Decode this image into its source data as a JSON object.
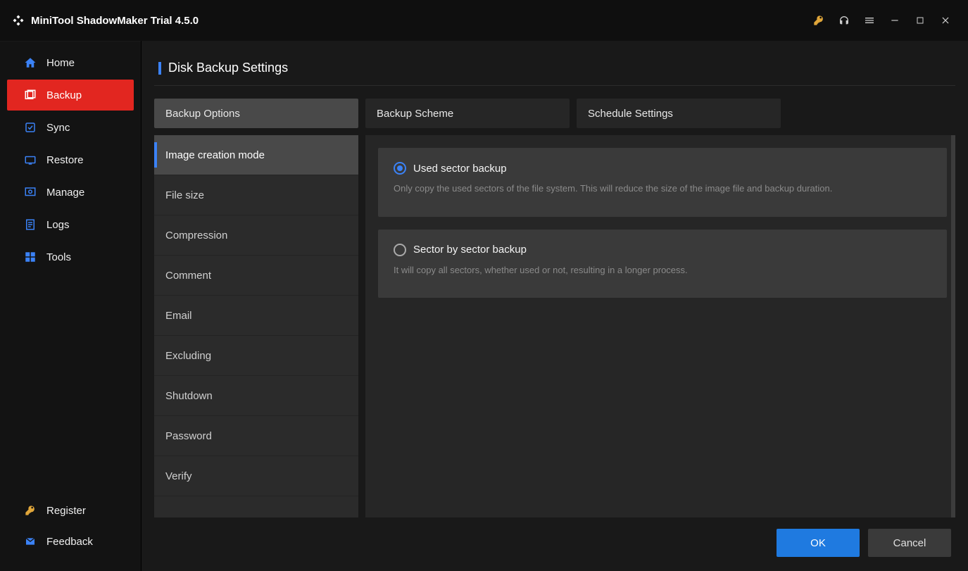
{
  "title": "MiniTool ShadowMaker Trial 4.5.0",
  "titlebar_icons": [
    "key-icon",
    "headphones-icon",
    "menu-icon",
    "minimize-icon",
    "maximize-icon",
    "close-icon"
  ],
  "sidebar": {
    "items": [
      {
        "label": "Home",
        "icon": "home-icon"
      },
      {
        "label": "Backup",
        "icon": "backup-icon",
        "active": true
      },
      {
        "label": "Sync",
        "icon": "sync-icon"
      },
      {
        "label": "Restore",
        "icon": "restore-icon"
      },
      {
        "label": "Manage",
        "icon": "manage-icon"
      },
      {
        "label": "Logs",
        "icon": "logs-icon"
      },
      {
        "label": "Tools",
        "icon": "tools-icon"
      }
    ],
    "bottom": [
      {
        "label": "Register",
        "icon": "key-icon"
      },
      {
        "label": "Feedback",
        "icon": "mail-icon"
      }
    ]
  },
  "page_title": "Disk Backup Settings",
  "tabs": [
    {
      "label": "Backup Options",
      "active": true
    },
    {
      "label": "Backup Scheme"
    },
    {
      "label": "Schedule Settings"
    }
  ],
  "option_list": [
    {
      "label": "Image creation mode",
      "active": true
    },
    {
      "label": "File size"
    },
    {
      "label": "Compression"
    },
    {
      "label": "Comment"
    },
    {
      "label": "Email"
    },
    {
      "label": "Excluding"
    },
    {
      "label": "Shutdown"
    },
    {
      "label": "Password"
    },
    {
      "label": "Verify"
    }
  ],
  "radio_options": [
    {
      "label": "Used sector backup",
      "desc": "Only copy the used sectors of the file system. This will reduce the size of the image file and backup duration.",
      "selected": true
    },
    {
      "label": "Sector by sector backup",
      "desc": "It will copy all sectors, whether used or not, resulting in a longer process.",
      "selected": false
    }
  ],
  "buttons": {
    "ok": "OK",
    "cancel": "Cancel"
  }
}
